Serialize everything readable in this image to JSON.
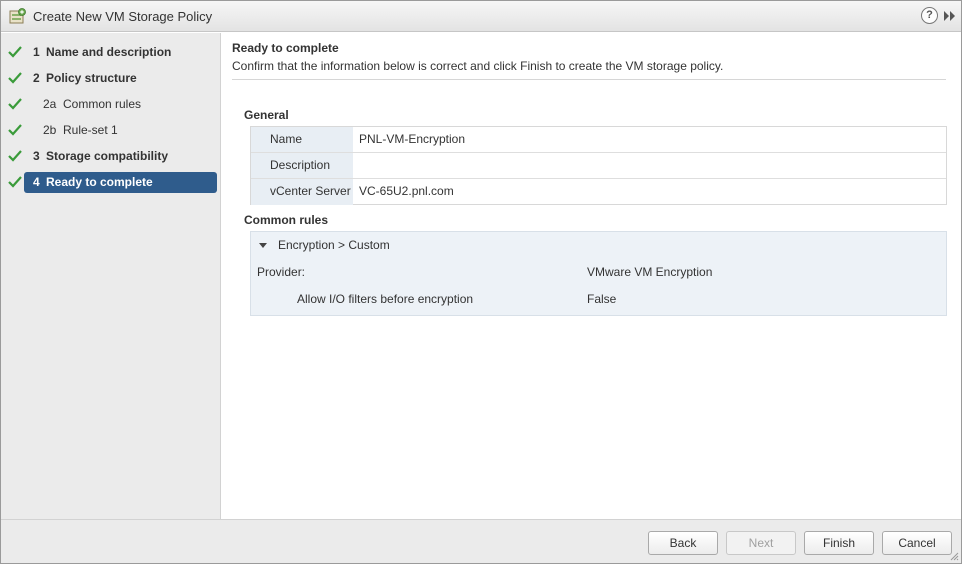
{
  "window": {
    "title": "Create New VM Storage Policy",
    "help_glyph": "?"
  },
  "colors": {
    "accent": "#2f5c8c",
    "check": "#3a9b3a",
    "sidebar_bg": "#ebebeb",
    "key_bg": "#e8eef4"
  },
  "steps": [
    {
      "num": "1",
      "label": "Name and description",
      "done": true
    },
    {
      "num": "2",
      "label": "Policy structure",
      "done": true
    },
    {
      "num": "2a",
      "label": "Common rules",
      "done": true
    },
    {
      "num": "2b",
      "label": "Rule-set 1",
      "done": true
    },
    {
      "num": "3",
      "label": "Storage compatibility",
      "done": true
    },
    {
      "num": "4",
      "label": "Ready to complete",
      "done": true,
      "active": true
    }
  ],
  "main": {
    "title": "Ready to complete",
    "description": "Confirm that the information below is correct and click Finish to create the VM storage policy.",
    "general": {
      "heading": "General",
      "rows": [
        {
          "key": "Name",
          "value": "PNL-VM-Encryption"
        },
        {
          "key": "Description",
          "value": ""
        },
        {
          "key": "vCenter Server",
          "value": "VC-65U2.pnl.com"
        }
      ]
    },
    "common_rules": {
      "heading": "Common rules",
      "rule_name": "Encryption > Custom",
      "provider_label": "Provider:",
      "provider_value": "VMware VM Encryption",
      "allow_label": "Allow I/O filters before encryption",
      "allow_value": "False"
    }
  },
  "footer": {
    "back": "Back",
    "next": "Next",
    "finish": "Finish",
    "cancel": "Cancel"
  }
}
